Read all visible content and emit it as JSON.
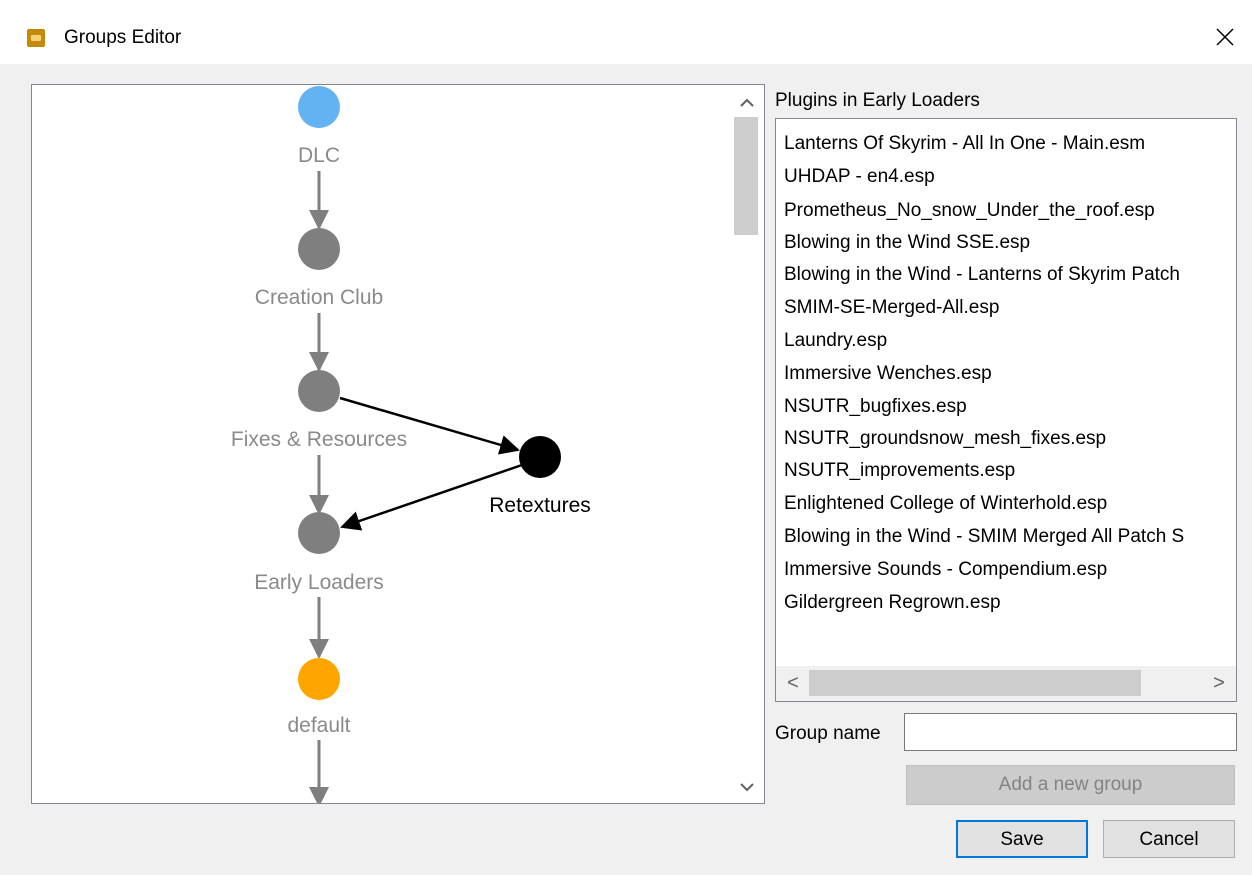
{
  "window": {
    "title": "Groups Editor",
    "app_icon": "app-icon",
    "close_icon": "close-icon"
  },
  "graph": {
    "nodes": [
      {
        "label": "DLC",
        "color": "#63b3f3"
      },
      {
        "label": "Creation Club",
        "color": "#7f7f7f"
      },
      {
        "label": "Fixes & Resources",
        "color": "#7f7f7f"
      },
      {
        "label": "Retextures",
        "color": "#000000"
      },
      {
        "label": "Early Loaders",
        "color": "#7f7f7f"
      },
      {
        "label": "default",
        "color": "#ffa500"
      }
    ],
    "scroll_up_icon": "chevron-up-icon",
    "scroll_down_icon": "chevron-down-icon"
  },
  "plugins": {
    "heading": "Plugins in Early Loaders",
    "items": [
      "Lanterns Of Skyrim - All In One - Main.esm",
      "UHDAP - en4.esp",
      "Prometheus_No_snow_Under_the_roof.esp",
      "Blowing in the Wind SSE.esp",
      "Blowing in the Wind - Lanterns of Skyrim Patch",
      "SMIM-SE-Merged-All.esp",
      "Laundry.esp",
      "Immersive Wenches.esp",
      "NSUTR_bugfixes.esp",
      "NSUTR_groundsnow_mesh_fixes.esp",
      "NSUTR_improvements.esp",
      "Enlightened College of Winterhold.esp",
      "Blowing in the Wind - SMIM Merged All Patch S",
      "Immersive Sounds - Compendium.esp",
      "Gildergreen Regrown.esp"
    ],
    "scroll_left": "<",
    "scroll_right": ">"
  },
  "form": {
    "group_name_label": "Group name",
    "group_name_value": "",
    "add_button": "Add a new group",
    "save_button": "Save",
    "cancel_button": "Cancel"
  }
}
